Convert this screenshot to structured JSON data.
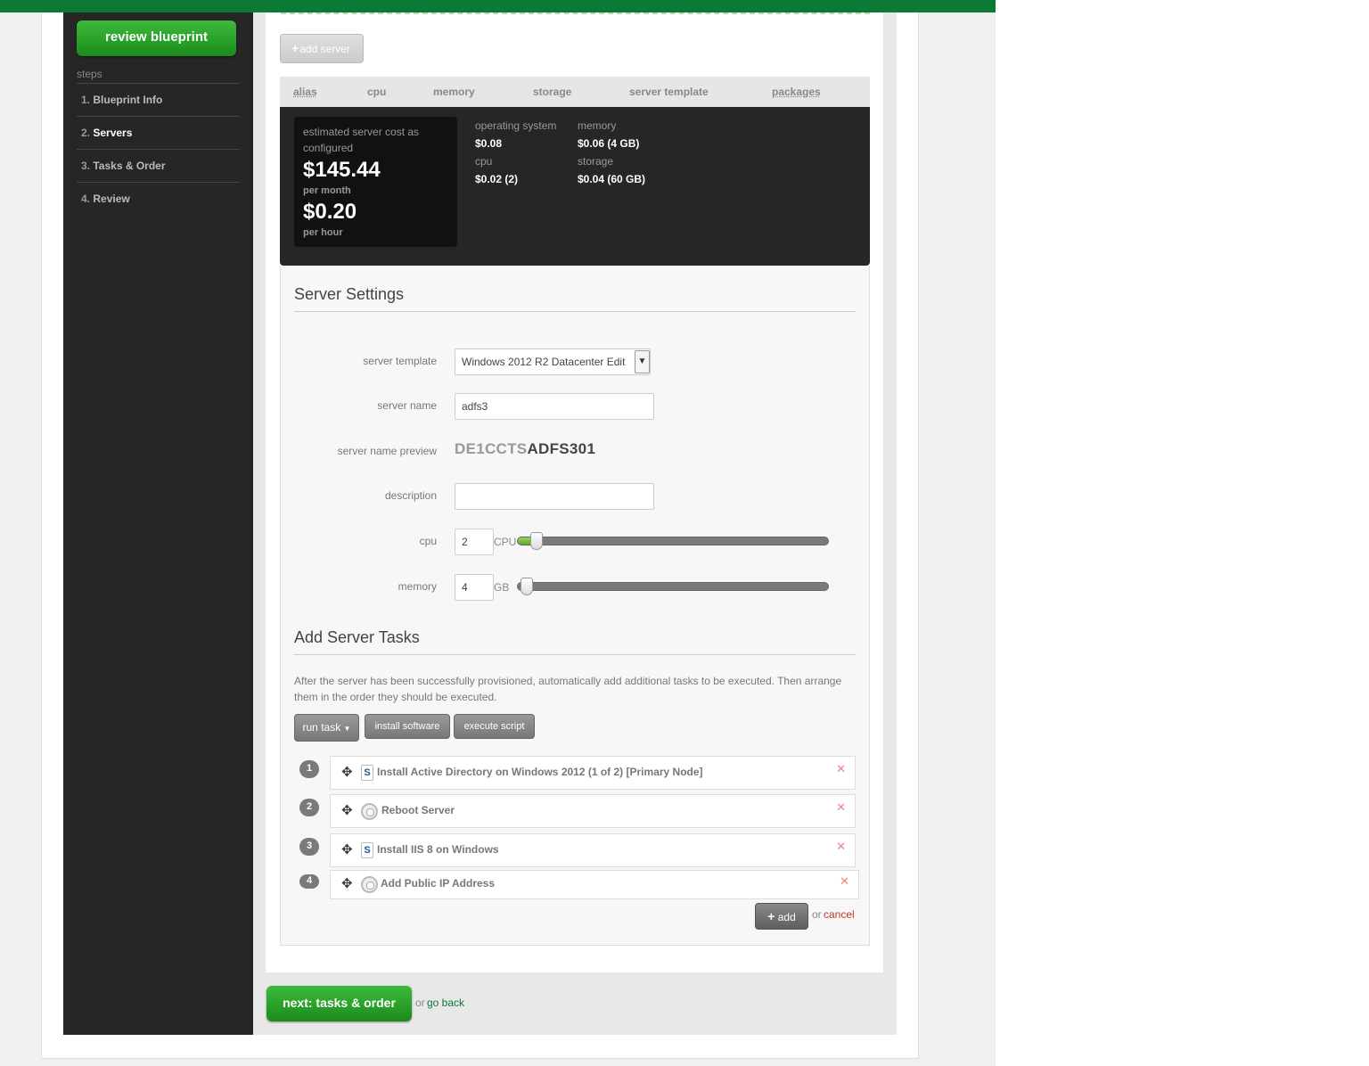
{
  "sidebar": {
    "review_button": "review blueprint",
    "steps_label": "steps",
    "steps": [
      {
        "num": "1.",
        "label": "Blueprint Info"
      },
      {
        "num": "2.",
        "label": "Servers"
      },
      {
        "num": "3.",
        "label": "Tasks & Order"
      },
      {
        "num": "4.",
        "label": "Review"
      }
    ]
  },
  "toolbar": {
    "add_server_label": "add server"
  },
  "table_headers": [
    "alias",
    "cpu",
    "memory",
    "storage",
    "server template",
    "packages"
  ],
  "cost": {
    "label": "estimated server cost as configured",
    "monthly": "$145.44",
    "monthly_unit": "per month",
    "hourly": "$0.20",
    "hourly_unit": "per hour",
    "breakdown": {
      "os_label": "operating system",
      "os_value": "$0.08",
      "cpu_label": "cpu",
      "cpu_value": "$0.02 (2)",
      "memory_label": "memory",
      "memory_value": "$0.06 (4 GB)",
      "storage_label": "storage",
      "storage_value": "$0.04 (60 GB)"
    }
  },
  "server_settings": {
    "title": "Server Settings",
    "template_label": "server template",
    "template_value": "Windows 2012 R2 Datacenter Edit",
    "name_label": "server name",
    "name_value": "adfs3",
    "preview_label": "server name preview",
    "preview_prefix": "DE1CCTS",
    "preview_suffix": "ADFS301",
    "description_label": "description",
    "description_value": "",
    "cpu_label": "cpu",
    "cpu_value": "2",
    "cpu_unit": "CPU",
    "cpu_slider_fraction": 0.05,
    "memory_label": "memory",
    "memory_value": "4",
    "memory_unit": "GB",
    "memory_slider_fraction": 0.02
  },
  "server_tasks": {
    "title": "Add Server Tasks",
    "help": "After the server has been successfully provisioned, automatically add additional tasks to be executed. Then arrange them in the order they should be executed.",
    "run_task_label": "run task",
    "install_software_label": "install software",
    "execute_script_label": "execute script",
    "tasks": [
      {
        "num": "1",
        "name": "Install Active Directory on Windows 2012 (1 of 2) [Primary Node]",
        "icon": "script-icon"
      },
      {
        "num": "2",
        "name": "Reboot Server",
        "icon": "gear-icon"
      },
      {
        "num": "3",
        "name": "Install IIS 8 on Windows",
        "icon": "script-icon"
      },
      {
        "num": "4",
        "name": "Add Public IP Address",
        "icon": "gear-icon"
      }
    ],
    "add_label": "add",
    "or_label": "or",
    "cancel_label": "cancel"
  },
  "footer": {
    "next_label": "next: tasks & order",
    "or_label": "or",
    "go_back_label": "go back"
  },
  "colors": {
    "brand_green": "#0a7a36",
    "button_green": "#2aa52a",
    "sidebar_bg": "#262626",
    "cancel_red": "#c0392b"
  }
}
